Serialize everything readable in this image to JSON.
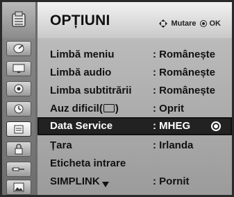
{
  "menu": {
    "title": "OPȚIUNI",
    "hint_move": "Mutare",
    "hint_ok": "OK"
  },
  "sidebar": {
    "items": [
      {
        "icon": "satellite-dish-icon"
      },
      {
        "icon": "tv-screen-icon"
      },
      {
        "icon": "speaker-icon"
      },
      {
        "icon": "clock-icon"
      },
      {
        "icon": "lock-icon"
      },
      {
        "icon": "options-icon"
      },
      {
        "icon": "input-plug-icon"
      },
      {
        "icon": "picture-icon"
      }
    ]
  },
  "options": [
    {
      "label": "Limbă meniu",
      "value": ": Românește"
    },
    {
      "label": "Limbă audio",
      "value": ": Românește"
    },
    {
      "label": "Limba subtitrării",
      "value": ": Românește"
    },
    {
      "label_prefix": "Auz dificil(",
      "label_suffix": ")",
      "value": ": Oprit"
    },
    {
      "label": "Data Service",
      "value": ": MHEG",
      "selected": true
    },
    {
      "label": "Țara",
      "value": ": Irlanda"
    },
    {
      "label": "Eticheta intrare",
      "value": ""
    },
    {
      "label": "SIMPLINK",
      "value": ": Pornit"
    }
  ]
}
